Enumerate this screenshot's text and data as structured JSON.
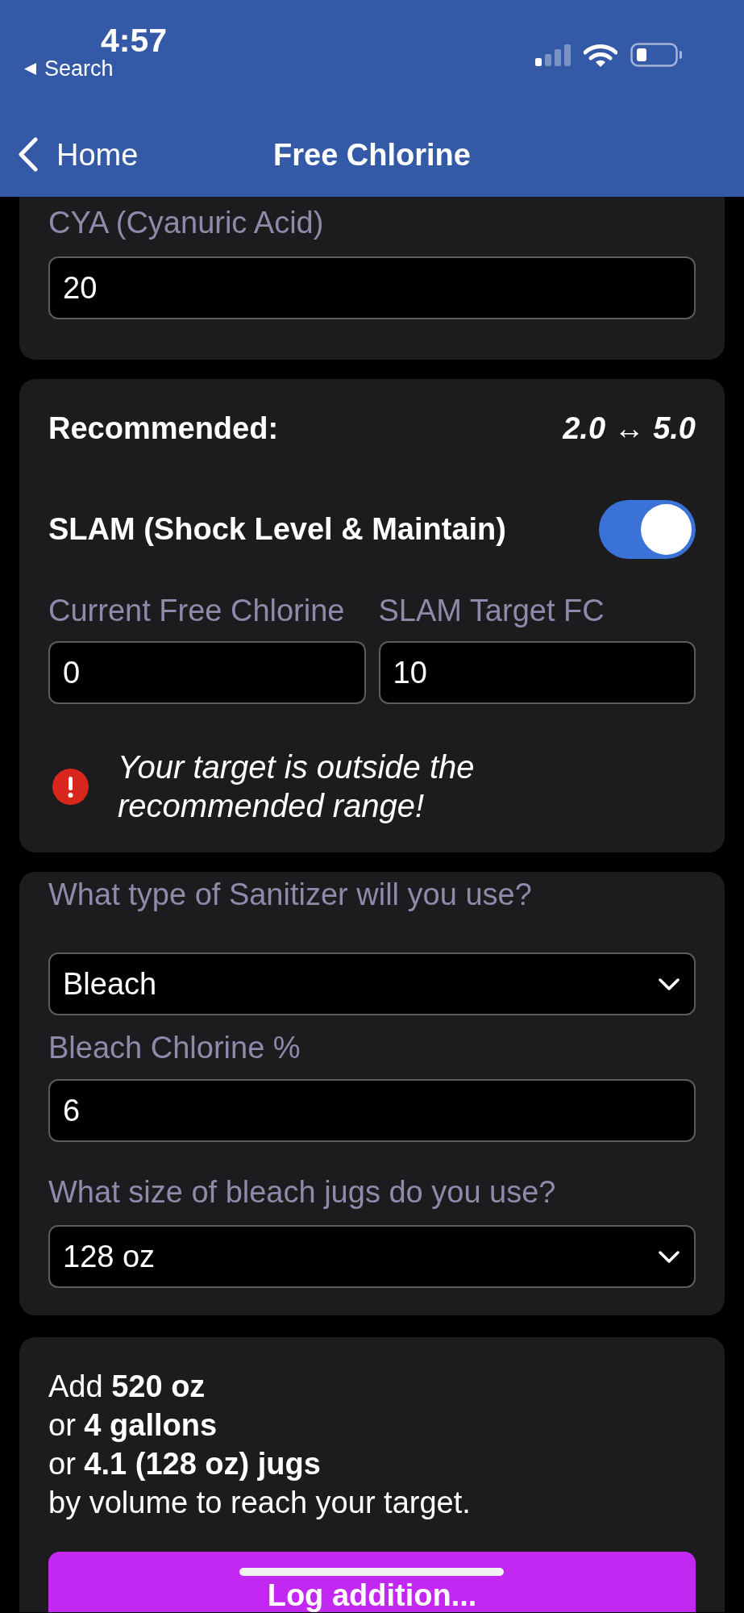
{
  "status_bar": {
    "time": "4:57",
    "back_link": "Search"
  },
  "nav_bar": {
    "back": "Home",
    "title": "Free Chlorine"
  },
  "cya_card": {
    "label": "CYA (Cyanuric Acid)",
    "value": "20"
  },
  "target_card": {
    "recommended_label": "Recommended:",
    "recommended_range": "2.0 ↔ 5.0",
    "slam": {
      "label": "SLAM (Shock Level & Maintain)",
      "on": true
    },
    "fields": [
      {
        "label": "Current Free Chlorine",
        "value": "0"
      },
      {
        "label": "SLAM Target FC",
        "value": "10"
      }
    ],
    "warning": "Your target is outside the recommended range!"
  },
  "sanitizer_card": {
    "fields": [
      {
        "kind": "select",
        "label": "What type of Sanitizer will you use?",
        "value": "Bleach"
      },
      {
        "kind": "input",
        "label": "Bleach Chlorine %",
        "value": "6"
      },
      {
        "kind": "select",
        "label": "What size of bleach jugs do you use?",
        "value": "128 oz"
      }
    ]
  },
  "result_card": {
    "lines": [
      "Add **520 oz**",
      "or **4 gallons**",
      "or **4.1 (128 oz) jugs**",
      "by volume to reach your target."
    ],
    "button": "Log addition..."
  }
}
